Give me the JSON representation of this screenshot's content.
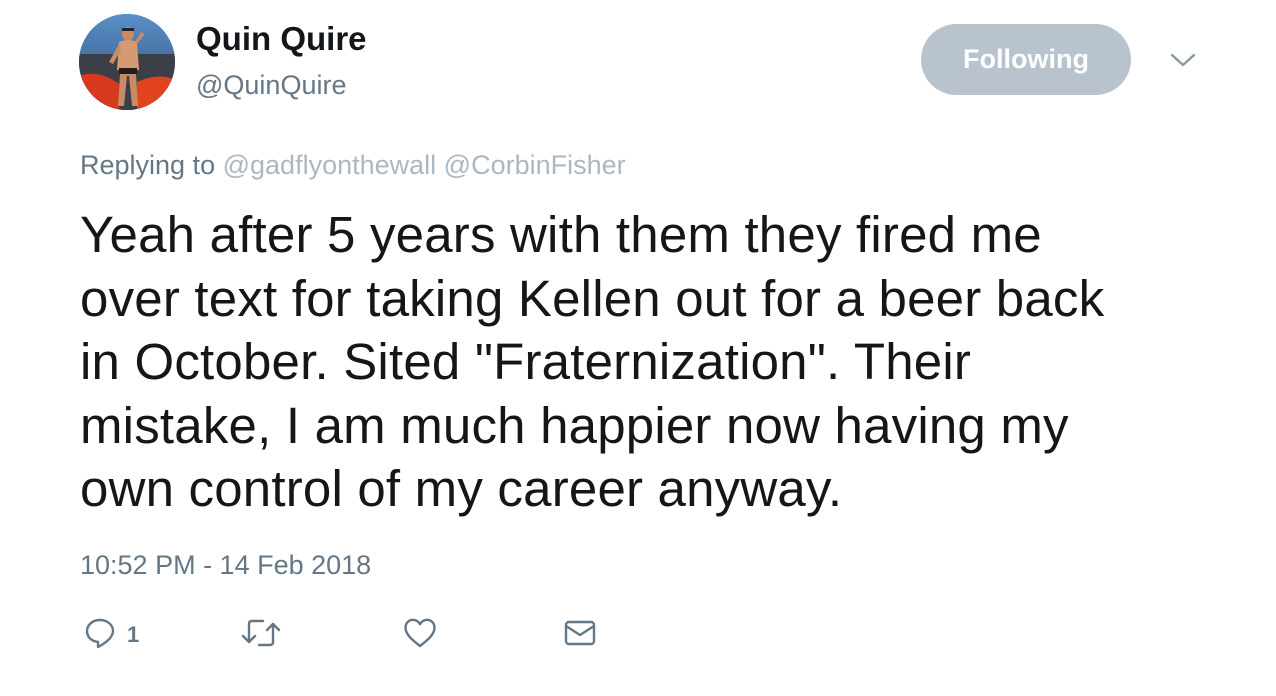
{
  "user": {
    "display_name": "Quin Quire",
    "handle": "@QuinQuire"
  },
  "follow_button": {
    "label": "Following"
  },
  "reply_context": {
    "prefix": "Replying to",
    "mentions": [
      "@gadflyonthewall",
      "@CorbinFisher"
    ]
  },
  "tweet": {
    "lines": [
      "Yeah after 5 years with them they fired me",
      "over text for taking Kellen out for a beer back",
      "in October. Sited \"Fraternization\". Their",
      "mistake, I am much happier now having my",
      "own control of my career anyway."
    ],
    "timestamp": "10:52 PM - 14 Feb 2018"
  },
  "actions": {
    "reply_count": "1",
    "icons": [
      "reply-icon",
      "retweet-icon",
      "like-icon",
      "direct-message-icon"
    ]
  },
  "colors": {
    "text": "#14171a",
    "secondary": "#657786",
    "mention": "#aab8c2",
    "follow_button_bg": "#b8c3cd"
  }
}
